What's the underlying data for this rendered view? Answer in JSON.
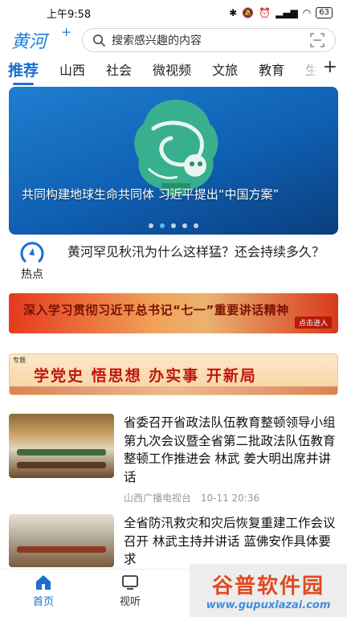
{
  "status_bar": {
    "time": "上午9:58",
    "battery": "63"
  },
  "header": {
    "logo_text": "黄河",
    "logo_plus": "+",
    "search_placeholder": "搜索感兴趣的内容"
  },
  "tabs": [
    {
      "label": "推荐",
      "active": true
    },
    {
      "label": "山西"
    },
    {
      "label": "社会"
    },
    {
      "label": "微视频"
    },
    {
      "label": "文旅"
    },
    {
      "label": "教育"
    },
    {
      "label": "生"
    }
  ],
  "tab_add": "+",
  "banner": {
    "caption": "共同构建地球生命共同体 习近平提出“中国方案”",
    "slide_count": 5,
    "active_slide": 2
  },
  "hot": {
    "label": "热点",
    "text": "黄河罕见秋汛为什么这样猛？还会持续多久？"
  },
  "promo1": {
    "text": "深入学习贯彻习近平总书记“七一”重要讲话精神",
    "button": "点击进入"
  },
  "promo2": {
    "tag": "专题",
    "text": "学党史 悟思想 办实事 开新局"
  },
  "news": [
    {
      "title": "省委召开省政法队伍教育整顿领导小组第九次会议暨全省第二批政法队伍教育整顿工作推进会 林武 姜大明出席并讲话",
      "source": "山西广播电视台",
      "time": "10-11 20:36"
    },
    {
      "title": "全省防汛救灾和灾后恢复重建工作会议召开 林武主持并讲话 蓝佛安作具体要求"
    }
  ],
  "bottom_nav": [
    {
      "label": "首页",
      "icon": "home-icon",
      "active": true
    },
    {
      "label": "视听",
      "icon": "tv-icon"
    }
  ],
  "watermark": {
    "title": "谷普软件园",
    "url": "www.gupuxlazai.com"
  },
  "colors": {
    "accent": "#1a6fd0",
    "promo_red": "#c4150c"
  }
}
